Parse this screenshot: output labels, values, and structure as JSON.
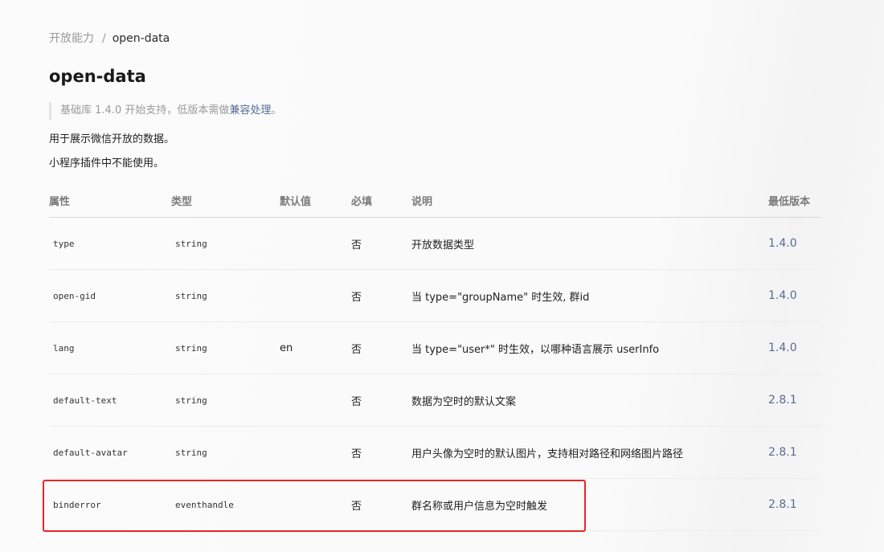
{
  "breadcrumb": {
    "parent": "开放能力",
    "separator": "/",
    "current": "open-data"
  },
  "title": "open-data",
  "tip": {
    "prefix": "基础库 1.4.0 开始支持，低版本需做",
    "link": "兼容处理",
    "suffix": "。"
  },
  "paragraphs": [
    "用于展示微信开放的数据。",
    "小程序插件中不能使用。"
  ],
  "table": {
    "headers": [
      "属性",
      "类型",
      "默认值",
      "必填",
      "说明",
      "最低版本"
    ],
    "rows": [
      {
        "name": "type",
        "type": "string",
        "default": "",
        "required": "否",
        "desc": "开放数据类型",
        "version": "1.4.0"
      },
      {
        "name": "open-gid",
        "type": "string",
        "default": "",
        "required": "否",
        "desc": "当 type=\"groupName\" 时生效, 群id",
        "version": "1.4.0"
      },
      {
        "name": "lang",
        "type": "string",
        "default": "en",
        "required": "否",
        "desc": "当 type=\"user*\" 时生效，以哪种语言展示 userInfo",
        "version": "1.4.0"
      },
      {
        "name": "default-text",
        "type": "string",
        "default": "",
        "required": "否",
        "desc": "数据为空时的默认文案",
        "version": "2.8.1"
      },
      {
        "name": "default-avatar",
        "type": "string",
        "default": "",
        "required": "否",
        "desc": "用户头像为空时的默认图片，支持相对路径和网络图片路径",
        "version": "2.8.1"
      },
      {
        "name": "binderror",
        "type": "eventhandle",
        "default": "",
        "required": "否",
        "desc": "群名称或用户信息为空时触发",
        "version": "2.8.1"
      }
    ]
  },
  "colors": {
    "link": "#576b95",
    "highlight": "#e6252a"
  }
}
